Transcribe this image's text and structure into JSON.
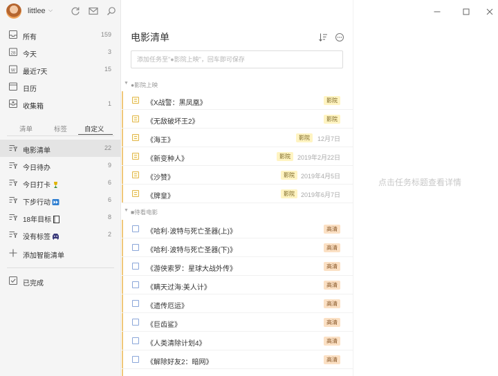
{
  "user": {
    "name": "littlee"
  },
  "sidebar": {
    "smart": [
      {
        "label": "所有",
        "count": "159"
      },
      {
        "label": "今天",
        "count": "3",
        "icon_text": "28"
      },
      {
        "label": "最近7天",
        "count": "15",
        "icon_text": "W"
      },
      {
        "label": "日历",
        "count": ""
      },
      {
        "label": "收集箱",
        "count": "1"
      }
    ],
    "tabs": [
      "清单",
      "标签",
      "自定义"
    ],
    "lists": [
      {
        "label": "电影清单",
        "count": "22"
      },
      {
        "label": "今日待办",
        "count": "9"
      },
      {
        "label": "今日打卡",
        "count": "6"
      },
      {
        "label": "下步行动",
        "count": "6"
      },
      {
        "label": "18年目标",
        "count": "8"
      },
      {
        "label": "没有标签",
        "count": "2"
      }
    ],
    "add_smart_list": "添加智能清单",
    "completed": "已完成"
  },
  "main": {
    "title": "电影清单",
    "add_placeholder": "添加任务至\"●影院上映\"，回车即可保存",
    "sections": [
      {
        "name": "●影院上映",
        "tasks": [
          {
            "title": "《X战警：黑凤凰》",
            "tag": "影院",
            "date": ""
          },
          {
            "title": "《无敌破坏王2》",
            "tag": "影院",
            "date": ""
          },
          {
            "title": "《海王》",
            "tag": "影院",
            "date": "12月7日"
          },
          {
            "title": "《新变种人》",
            "tag": "影院",
            "date": "2019年2月22日"
          },
          {
            "title": "《沙赞》",
            "tag": "影院",
            "date": "2019年4月5日"
          },
          {
            "title": "《牌皇》",
            "tag": "影院",
            "date": "2019年6月7日"
          }
        ]
      },
      {
        "name": "■待看电影",
        "tasks": [
          {
            "title": "《哈利·波特与死亡圣器(上)》",
            "tag": "高清"
          },
          {
            "title": "《哈利·波特与死亡圣器(下)》",
            "tag": "高清"
          },
          {
            "title": "《游侠索罗：星球大战外传》",
            "tag": "高清"
          },
          {
            "title": "《瞒天过海:美人计》",
            "tag": "高清"
          },
          {
            "title": "《遗传厄运》",
            "tag": "高清"
          },
          {
            "title": "《巨齿鲨》",
            "tag": "高清"
          },
          {
            "title": "《人类清除计划4》",
            "tag": "高清"
          },
          {
            "title": "《解除好友2：暗网》",
            "tag": "高清"
          }
        ]
      }
    ]
  },
  "detail": {
    "hint": "点击任务标题查看详情"
  },
  "colors": {
    "accent_bar": "#f0c87a",
    "tag_yingyuan": "#fff4c2",
    "tag_gaoqing": "#fbe0c4",
    "checkbox_border": "#8aa6d9"
  }
}
